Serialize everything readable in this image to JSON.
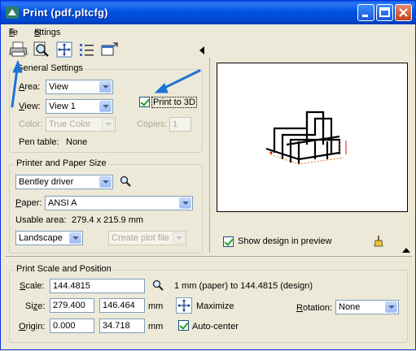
{
  "window": {
    "title": "Print  (pdf.pltcfg)",
    "caption_buttons": [
      "minimize-icon",
      "maximize-icon",
      "close-icon"
    ]
  },
  "menu": [
    {
      "label": "File",
      "accel": "F"
    },
    {
      "label": "Settings",
      "accel": "S"
    }
  ],
  "toolbar": {
    "icons": [
      "printer-icon",
      "print-preview-icon",
      "fit-to-paper-icon",
      "list-icon",
      "window-icon"
    ]
  },
  "general": {
    "title": "General Settings",
    "area_label": "Area:",
    "area_value": "View",
    "view_label": "View:",
    "view_value": "View 1",
    "print3d_label": "Print to 3D",
    "print3d_checked": true,
    "color_label": "Color:",
    "color_value": "True Color",
    "copies_label": "Copies:",
    "copies_value": "1",
    "pentable_label": "Pen table:",
    "pentable_value": "None"
  },
  "printer": {
    "title": "Printer and Paper Size",
    "driver_value": "Bentley driver",
    "paper_label": "Paper:",
    "paper_value": "ANSI A",
    "usable_label": "Usable area:",
    "usable_value": "279.4 x 215.9 mm",
    "orientation_value": "Landscape",
    "create_plot_label": "Create plot file"
  },
  "preview": {
    "show_design_label": "Show design in preview",
    "show_design_checked": true
  },
  "scale": {
    "title": "Print Scale and Position",
    "scale_label": "Scale:",
    "scale_value": "144.4815",
    "scale_desc": "1 mm (paper) to 144.4815  (design)",
    "size_label": "Size:",
    "size_w": "279.400",
    "size_h": "146.464",
    "size_unit": "mm",
    "maximize_label": "Maximize",
    "rotation_label": "Rotation:",
    "rotation_value": "None",
    "origin_label": "Origin:",
    "origin_x": "0.000",
    "origin_y": "34.718",
    "origin_unit": "mm",
    "autocenter_label": "Auto-center",
    "autocenter_checked": true
  },
  "colors": {
    "titlebar": "#0054E3",
    "annotation_arrow": "#1E73D8",
    "dialog_bg": "#ECE9D8"
  }
}
